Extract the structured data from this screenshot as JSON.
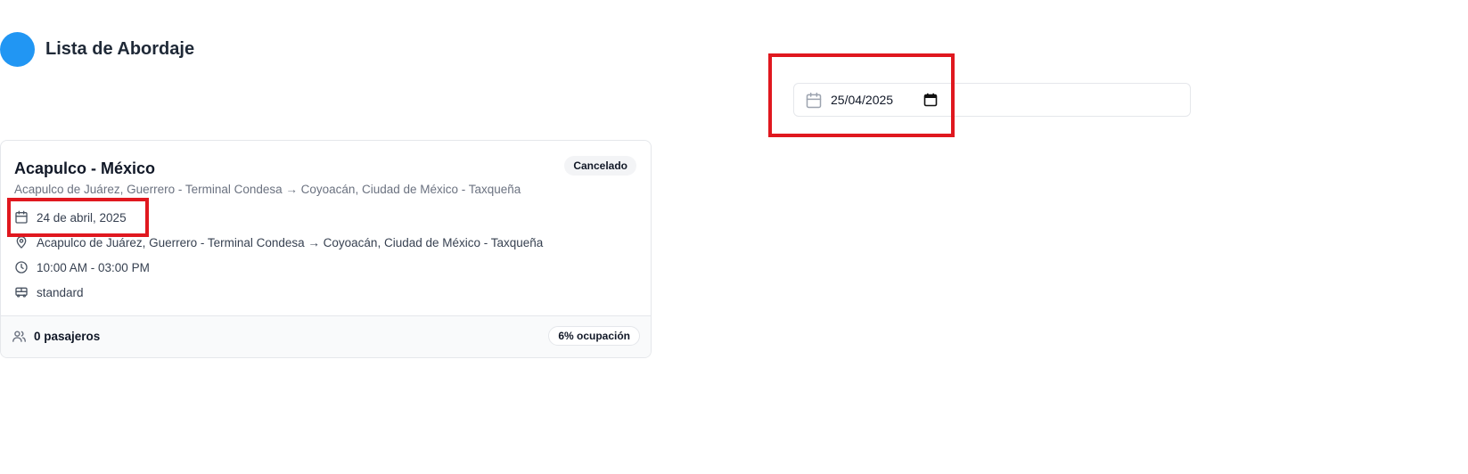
{
  "header": {
    "title": "Lista de Abordaje",
    "avatar_color": "#2196f3"
  },
  "date_filter": {
    "value": "25/04/2025"
  },
  "trip_card": {
    "title": "Acapulco - México",
    "status": "Cancelado",
    "route": "Acapulco de Juárez, Guerrero - Terminal Condesa → Coyoacán, Ciudad de México - Taxqueña",
    "date": "24 de abril, 2025",
    "location": "Acapulco de Juárez, Guerrero - Terminal Condesa → Coyoacán, Ciudad de México - Taxqueña",
    "schedule": "10:00 AM - 03:00 PM",
    "bus_type": "standard",
    "passengers": "0 pasajeros",
    "occupancy": "6% ocupación"
  },
  "icons": {
    "calendar": "calendar-icon",
    "location": "map-pin-icon",
    "clock": "clock-icon",
    "bus": "bus-icon",
    "users": "users-icon"
  },
  "colors": {
    "highlight": "#e0181f",
    "accent": "#2196f3"
  }
}
